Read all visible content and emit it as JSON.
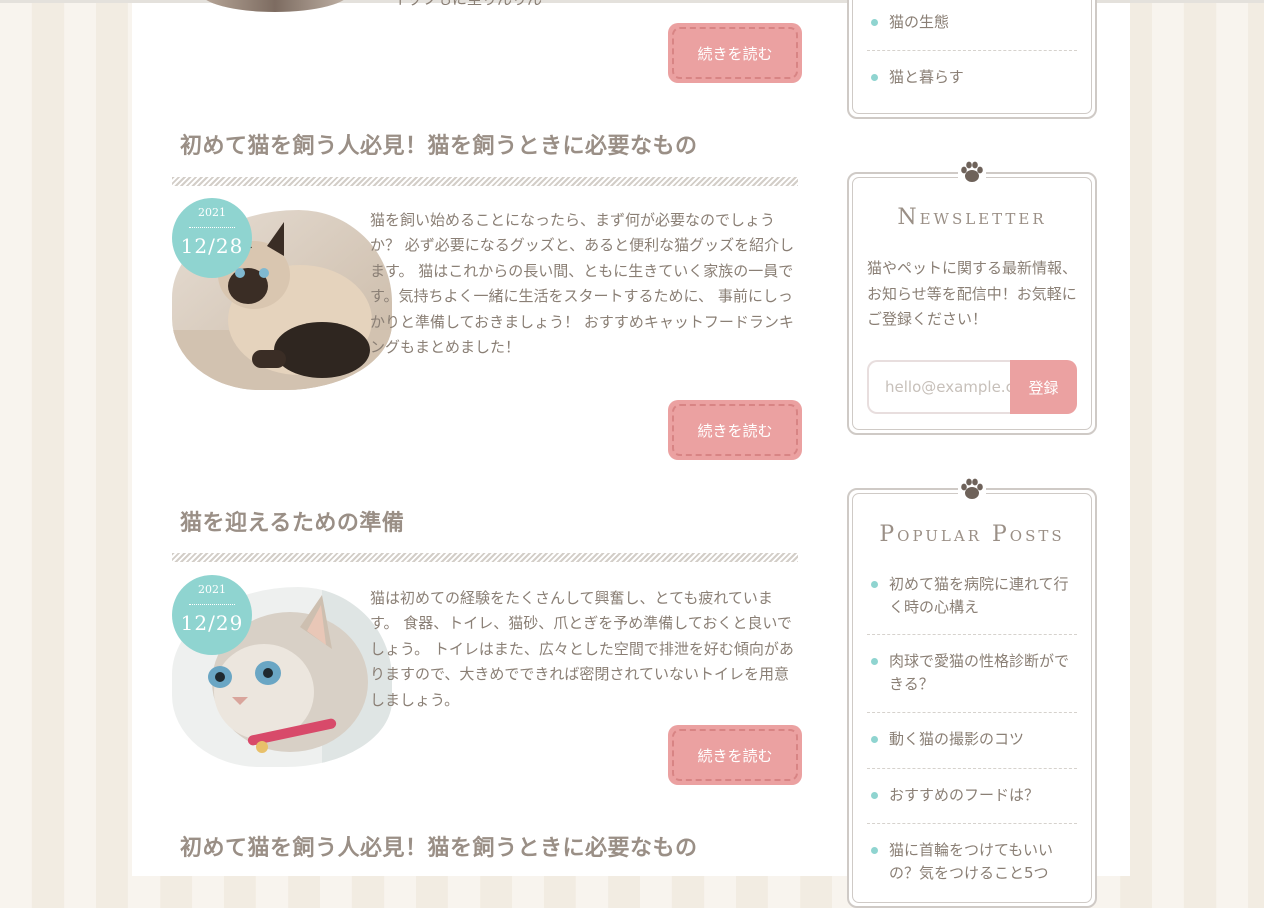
{
  "colors": {
    "accent_pink": "#eba1a1",
    "accent_teal": "#8fd4d0",
    "text": "#8a7f75"
  },
  "articles": [
    {
      "partial_text": "イッフもに至りんりん",
      "more_label": "続きを読む"
    },
    {
      "title": "初めて猫を飼う人必見！猫を飼うときに必要なもの",
      "date_year": "2021",
      "date_md": "12/28",
      "excerpt": "猫を飼い始めることになったら、まず何が必要なのでしょうか？ 必ず必要になるグッズと、あると便利な猫グッズを紹介します。 猫はこれからの長い間、ともに生きていく家族の一員です。気持ちよく一緒に生活をスタートするために、 事前にしっかりと準備しておきましょう！ おすすめキャットフードランキングもまとめました！",
      "more_label": "続きを読む"
    },
    {
      "title": "猫を迎えるための準備",
      "date_year": "2021",
      "date_md": "12/29",
      "excerpt": "猫は初めての経験をたくさんして興奮し、とても疲れています。 食器、トイレ、猫砂、爪とぎを予め準備しておくと良いでしょう。 トイレはまた、広々とした空間で排泄を好む傾向がありますので、大きめでできれば密閉されていないトイレを用意しましょう。",
      "more_label": "続きを読む"
    },
    {
      "title": "初めて猫を飼う人必見！猫を飼うときに必要なもの"
    }
  ],
  "sidebar": {
    "categories": [
      "猫の生態",
      "猫と暮らす"
    ],
    "newsletter": {
      "title": "Newsletter",
      "description": "猫やペットに関する最新情報、お知らせ等を配信中！お気軽にご登録ください！",
      "placeholder": "hello@example.com",
      "button_label": "登録"
    },
    "popular": {
      "title": "Popular Posts",
      "items": [
        "初めて猫を病院に連れて行く時の心構え",
        "肉球で愛猫の性格診断ができる？",
        "動く猫の撮影のコツ",
        "おすすめのフードは？",
        "猫に首輪をつけてもいいの？気をつけること5つ"
      ]
    }
  }
}
